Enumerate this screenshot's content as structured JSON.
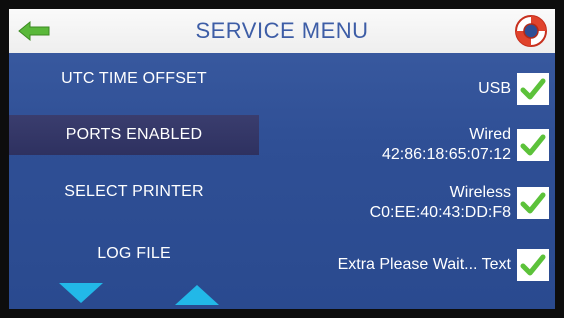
{
  "header": {
    "title": "SERVICE MENU",
    "back_icon": "green-left-arrow-icon",
    "help_icon": "life-ring-icon"
  },
  "menu": {
    "items": [
      {
        "label": "UTC TIME OFFSET",
        "selected": false
      },
      {
        "label": "PORTS ENABLED",
        "selected": true
      },
      {
        "label": "SELECT PRINTER",
        "selected": false
      },
      {
        "label": "LOG FILE",
        "selected": false
      }
    ],
    "scroll_down_icon": "triangle-down-icon",
    "scroll_up_icon": "triangle-up-icon"
  },
  "options": [
    {
      "label": "USB",
      "sub": "",
      "checked": true
    },
    {
      "label": "Wired",
      "sub": "42:86:18:65:07:12",
      "checked": true
    },
    {
      "label": "Wireless",
      "sub": "C0:EE:40:43:DD:F8",
      "checked": true
    },
    {
      "label": "Extra Please Wait... Text",
      "sub": "",
      "checked": true
    }
  ],
  "colors": {
    "accent_blue": "#3d5da6",
    "check_green": "#5cc23a",
    "selected_row": "#33366a",
    "arrow_cyan": "#22b8e8"
  }
}
